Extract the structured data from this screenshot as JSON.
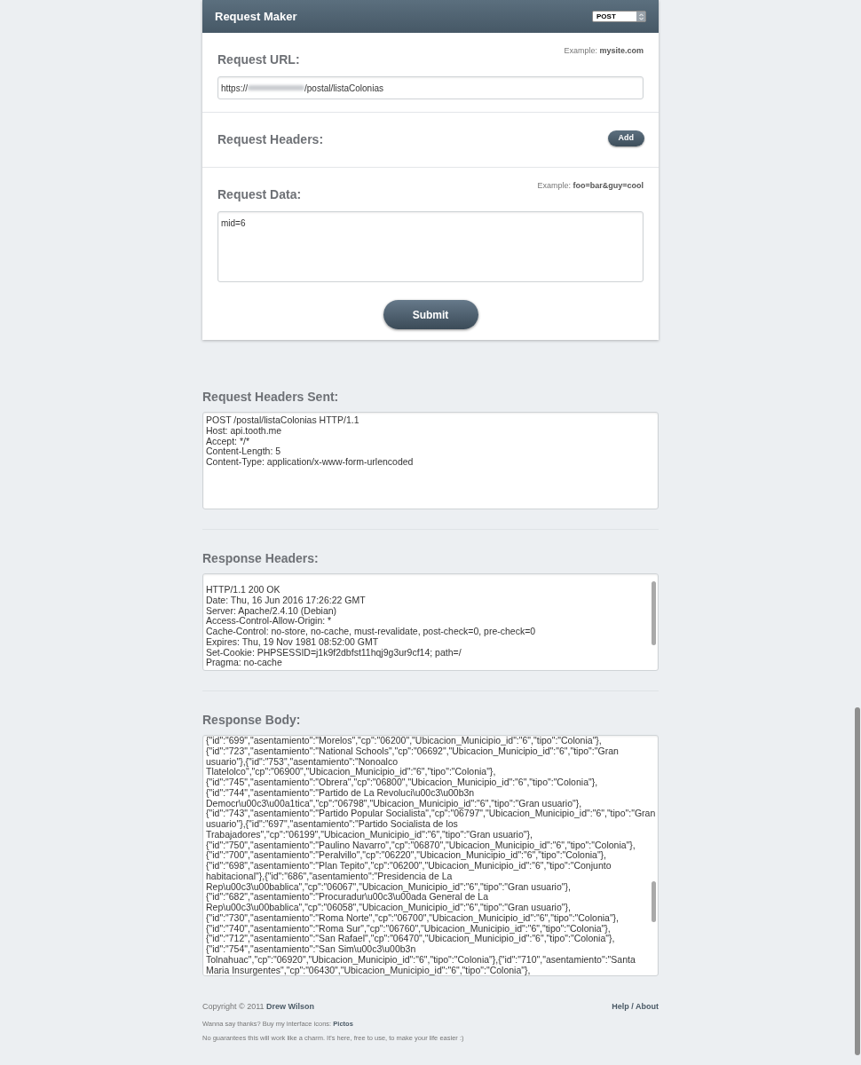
{
  "header": {
    "title": "Request Maker",
    "method": "POST"
  },
  "request_url": {
    "label": "Request URL:",
    "example_prefix": "Example:",
    "example": "mysite.com",
    "value_start": "https://",
    "value_end": "/postal/listaColonias"
  },
  "request_headers": {
    "label": "Request Headers:",
    "button": "Add"
  },
  "request_data": {
    "label": "Request Data:",
    "example_prefix": "Example:",
    "example": "foo=bar&guy=cool",
    "value": "mid=6"
  },
  "submit": "Submit",
  "headers_sent": {
    "label": "Request Headers Sent:",
    "lines": [
      "POST /postal/listaColonias HTTP/1.1",
      "Host: api.tooth.me",
      "Accept: */*",
      "Content-Length: 5",
      "Content-Type: application/x-www-form-urlencoded"
    ]
  },
  "response_headers": {
    "label": "Response Headers:",
    "lines": [
      "HTTP/1.1 200 OK",
      "Date: Thu, 16 Jun 2016 17:26:22 GMT",
      "Server: Apache/2.4.10 (Debian)",
      "Access-Control-Allow-Origin: *",
      "Cache-Control: no-store, no-cache, must-revalidate, post-check=0, pre-check=0",
      "Expires: Thu, 19 Nov 1981 08:52:00 GMT",
      "Set-Cookie: PHPSESSID=j1k9f2dbfst11hqj9g3ur9cf14; path=/",
      "Pragma: no-cache"
    ]
  },
  "response_body": {
    "label": "Response Body:",
    "lines": [
      "{\"id\":\"699\",\"asentamiento\":\"Morelos\",\"cp\":\"06200\",\"Ubicacion_Municipio_id\":\"6\",\"tipo\":\"Colonia\"},",
      "{\"id\":\"723\",\"asentamiento\":\"National Schools\",\"cp\":\"06692\",\"Ubicacion_Municipio_id\":\"6\",\"tipo\":\"Gran",
      "usuario\"},{\"id\":\"753\",\"asentamiento\":\"Nonoalco",
      "Tlatelolco\",\"cp\":\"06900\",\"Ubicacion_Municipio_id\":\"6\",\"tipo\":\"Colonia\"},",
      "{\"id\":\"745\",\"asentamiento\":\"Obrera\",\"cp\":\"06800\",\"Ubicacion_Municipio_id\":\"6\",\"tipo\":\"Colonia\"},",
      "{\"id\":\"744\",\"asentamiento\":\"Partido de La Revoluci\\u00c3\\u00b3n",
      "Democr\\u00c3\\u00a1tica\",\"cp\":\"06798\",\"Ubicacion_Municipio_id\":\"6\",\"tipo\":\"Gran usuario\"},",
      "{\"id\":\"743\",\"asentamiento\":\"Partido Popular Socialista\",\"cp\":\"06797\",\"Ubicacion_Municipio_id\":\"6\",\"tipo\":\"Gran",
      "usuario\"},{\"id\":\"697\",\"asentamiento\":\"Partido Socialista de los",
      "Trabajadores\",\"cp\":\"06199\",\"Ubicacion_Municipio_id\":\"6\",\"tipo\":\"Gran usuario\"},",
      "{\"id\":\"750\",\"asentamiento\":\"Paulino Navarro\",\"cp\":\"06870\",\"Ubicacion_Municipio_id\":\"6\",\"tipo\":\"Colonia\"},",
      "{\"id\":\"700\",\"asentamiento\":\"Peralvillo\",\"cp\":\"06220\",\"Ubicacion_Municipio_id\":\"6\",\"tipo\":\"Colonia\"},",
      "{\"id\":\"698\",\"asentamiento\":\"Plan Tepito\",\"cp\":\"06200\",\"Ubicacion_Municipio_id\":\"6\",\"tipo\":\"Conjunto",
      "habitacional\"},{\"id\":\"686\",\"asentamiento\":\"Presidencia de La",
      "Rep\\u00c3\\u00bablica\",\"cp\":\"06067\",\"Ubicacion_Municipio_id\":\"6\",\"tipo\":\"Gran usuario\"},",
      "{\"id\":\"682\",\"asentamiento\":\"Procuradur\\u00c3\\u00ada General de La",
      "Rep\\u00c3\\u00bablica\",\"cp\":\"06058\",\"Ubicacion_Municipio_id\":\"6\",\"tipo\":\"Gran usuario\"},",
      "{\"id\":\"730\",\"asentamiento\":\"Roma Norte\",\"cp\":\"06700\",\"Ubicacion_Municipio_id\":\"6\",\"tipo\":\"Colonia\"},",
      "{\"id\":\"740\",\"asentamiento\":\"Roma Sur\",\"cp\":\"06760\",\"Ubicacion_Municipio_id\":\"6\",\"tipo\":\"Colonia\"},",
      "{\"id\":\"712\",\"asentamiento\":\"San Rafael\",\"cp\":\"06470\",\"Ubicacion_Municipio_id\":\"6\",\"tipo\":\"Colonia\"},",
      "{\"id\":\"754\",\"asentamiento\":\"San Sim\\u00c3\\u00b3n",
      "Tolnahuac\",\"cp\":\"06920\",\"Ubicacion_Municipio_id\":\"6\",\"tipo\":\"Colonia\"},{\"id\":\"710\",\"asentamiento\":\"Santa",
      "Maria Insurgentes\",\"cp\":\"06430\",\"Ubicacion_Municipio_id\":\"6\",\"tipo\":\"Colonia\"},"
    ]
  },
  "footer": {
    "copyright": "Copyright © 2011",
    "author": "Drew Wilson",
    "help": "Help / About",
    "thanks": "Wanna say thanks? Buy my interface icons:",
    "thanks_link": "Pictos",
    "note": "No guarantees this will work like a charm. It's here, free to use, to make your life easier :)"
  }
}
